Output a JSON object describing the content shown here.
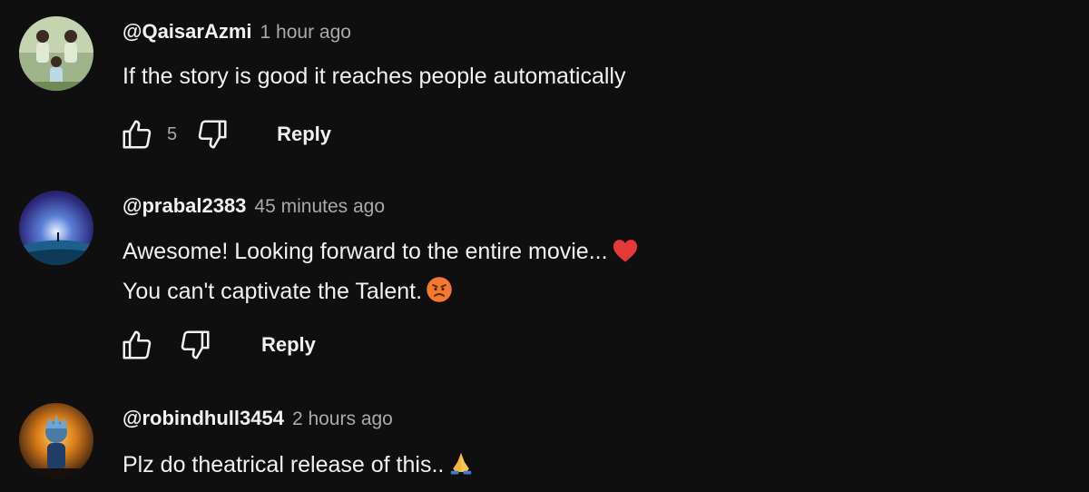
{
  "comments": [
    {
      "author": "@QaisarAzmi",
      "time": "1 hour ago",
      "lines": [
        "If the story is good it reaches people automatically"
      ],
      "likes": "5",
      "reply_label": "Reply"
    },
    {
      "author": "@prabal2383",
      "time": "45 minutes ago",
      "lines": [
        "Awesome! Looking forward to the entire movie...",
        "You can't captivate the Talent."
      ],
      "likes": "",
      "reply_label": "Reply"
    },
    {
      "author": "@robindhull3454",
      "time": "2 hours ago",
      "lines": [
        "Plz do theatrical release of this.."
      ],
      "likes": "",
      "reply_label": "Reply"
    }
  ],
  "icons": {
    "like": "thumbs-up-icon",
    "dislike": "thumbs-down-icon",
    "heart": "red-heart-emoji",
    "angry": "angry-face-emoji",
    "pray": "folded-hands-emoji"
  },
  "colors": {
    "background": "#0f0f0f",
    "text": "#f1f1f1",
    "secondary": "#aaaaaa"
  }
}
